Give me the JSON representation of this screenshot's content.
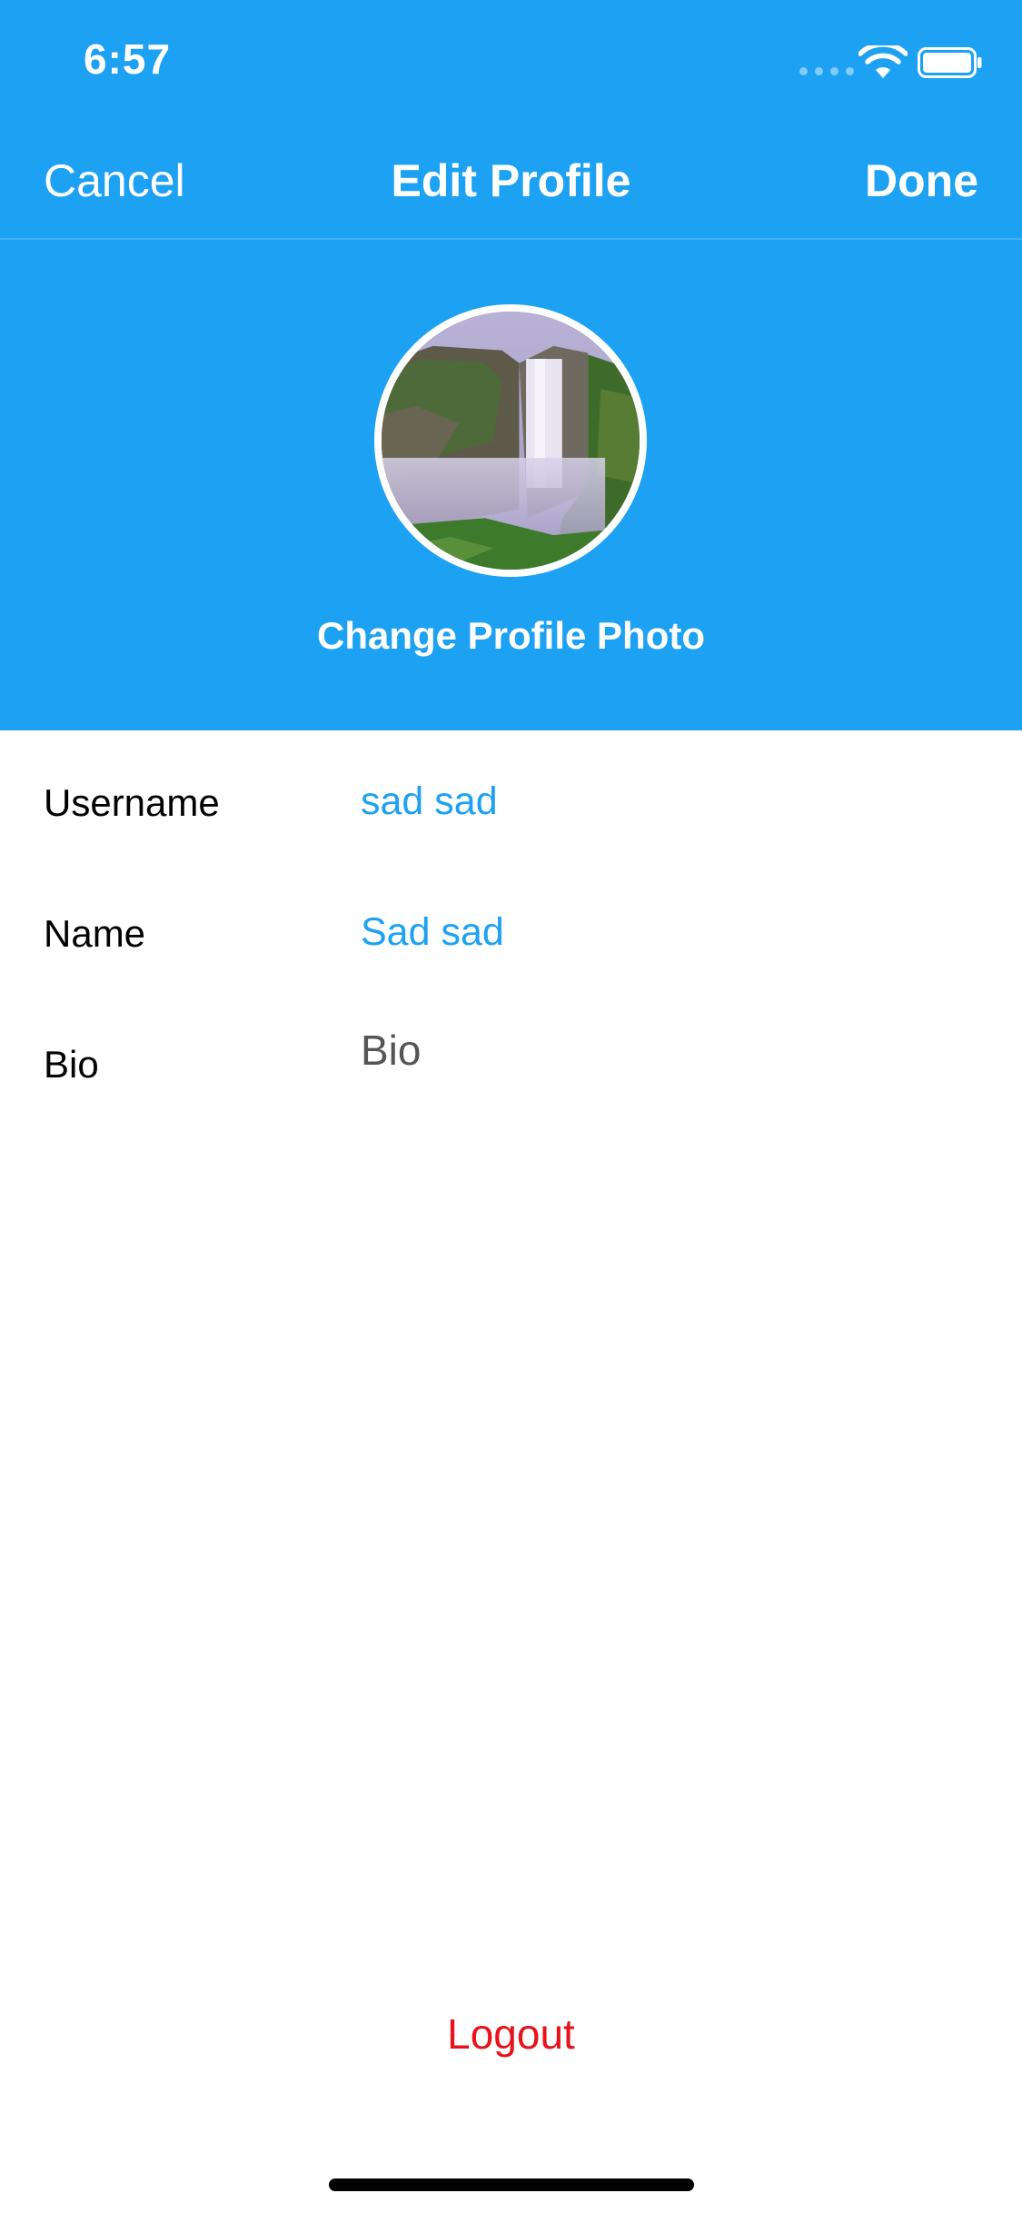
{
  "status_bar": {
    "time": "6:57",
    "icons": [
      "cellular-signal-icon",
      "wifi-icon",
      "battery-icon"
    ]
  },
  "nav": {
    "cancel_label": "Cancel",
    "title": "Edit Profile",
    "done_label": "Done"
  },
  "profile": {
    "avatar_icon": "waterfall-photo",
    "change_photo_label": "Change Profile Photo"
  },
  "form": {
    "rows": [
      {
        "label": "Username",
        "value": "sad sad"
      },
      {
        "label": "Name",
        "value": "Sad sad"
      },
      {
        "label": "Bio",
        "placeholder": "Bio"
      }
    ]
  },
  "logout_label": "Logout",
  "colors": {
    "accent": "#1DA1F2",
    "destructive": "#E8121A"
  }
}
